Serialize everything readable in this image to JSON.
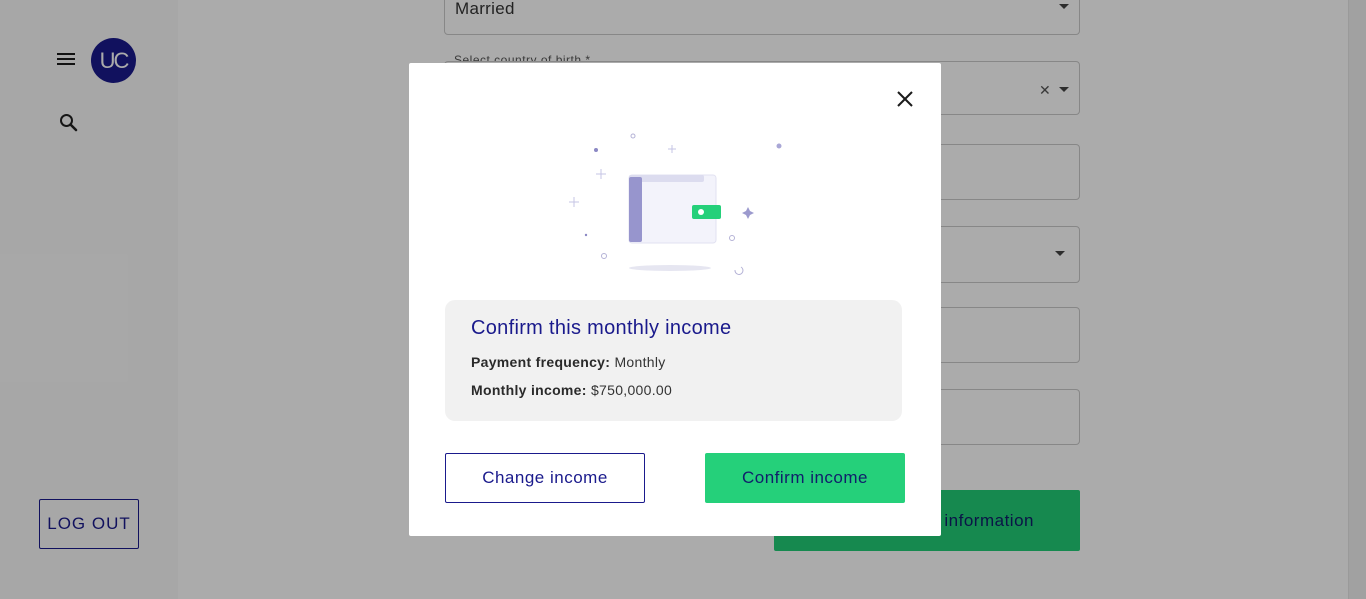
{
  "app": {
    "avatar_initials": "UC",
    "logout_label": "LOG OUT"
  },
  "form": {
    "marital_status_value": "Married",
    "country_of_birth_label": "Select country of birth *",
    "submit_label_visible": "information"
  },
  "modal": {
    "title": "Confirm this monthly income",
    "frequency_label": "Payment frequency:",
    "frequency_value": "Monthly",
    "income_label": "Monthly income:",
    "income_value": "$750,000.00",
    "change_label": "Change income",
    "confirm_label": "Confirm income"
  },
  "colors": {
    "brand": "#1a1a8c",
    "accent_green": "#25d07a",
    "card_bg": "#f1f1f1"
  },
  "icons": [
    "menu-icon",
    "search-icon",
    "close-icon",
    "wallet-illustration"
  ]
}
